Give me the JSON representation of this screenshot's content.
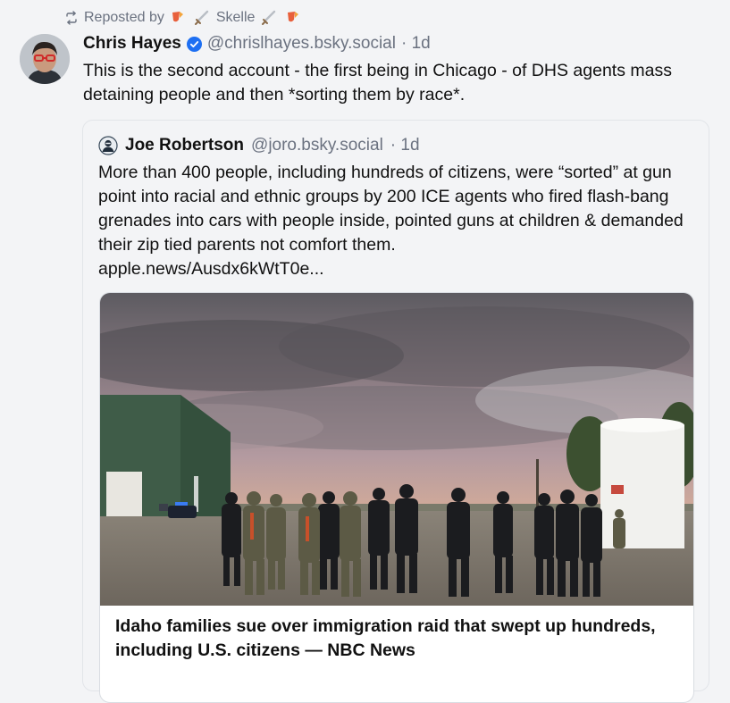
{
  "repost": {
    "prefix": "Reposted by",
    "name": "Skelle",
    "icon": "repost-icon"
  },
  "post": {
    "author_name": "Chris Hayes",
    "handle": "@chrislhayes.bsky.social",
    "time": "· 1d",
    "verified_icon": "verified-badge-icon",
    "text": "This is the second account - the first being in Chicago - of DHS agents mass detaining people and then *sorting them by race*."
  },
  "quote": {
    "author_name": "Joe Robertson",
    "handle": "@joro.bsky.social",
    "time": "· 1d",
    "text": "More than 400 people, including hundreds of citizens, were “sorted” at gun point into racial and ethnic groups by 200 ICE agents who fired flash-bang grenades into cars with people inside, pointed guns at children & demanded their zip tied parents not comfort them.",
    "link": "apple.news/Ausdx6kWtT0e..."
  },
  "card": {
    "title": "Idaho families sue over immigration raid that swept up hundreds, including U.S. citizens — NBC News"
  },
  "colors": {
    "muted": "#6b7280",
    "verified": "#1d6ff2",
    "background": "#f3f4f6"
  }
}
